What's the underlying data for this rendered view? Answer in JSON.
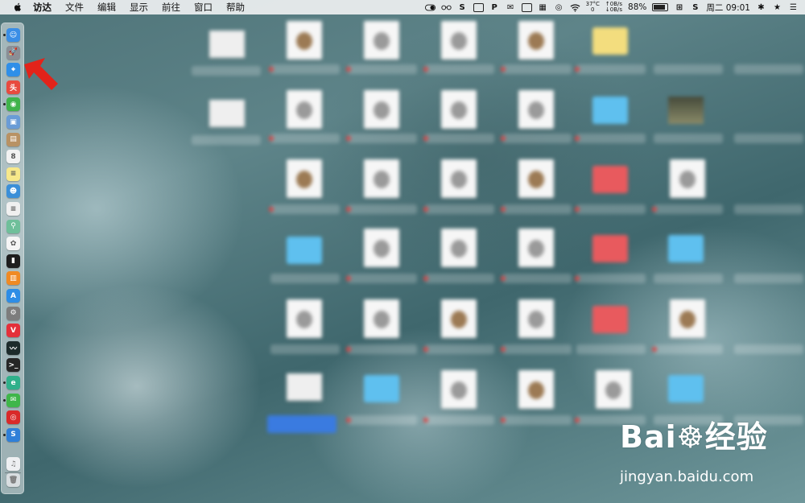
{
  "menubar": {
    "items": [
      "访达",
      "文件",
      "编辑",
      "显示",
      "前往",
      "窗口",
      "帮助"
    ],
    "status": {
      "temperature": "37°C",
      "temperature_sub": "0",
      "net_up": "↑0B/s",
      "net_down": "↓0B/s",
      "battery": "88%",
      "clock": "周二 09:01"
    }
  },
  "dock": {
    "apps": [
      {
        "name": "finder",
        "color": "#3a8ee6",
        "glyph": "☺"
      },
      {
        "name": "launchpad",
        "color": "#8a8f96",
        "glyph": "🚀"
      },
      {
        "name": "safari",
        "color": "#2f8fe8",
        "glyph": "⌖"
      },
      {
        "name": "toutiao",
        "color": "#e84a3f",
        "glyph": "头"
      },
      {
        "name": "android-tool",
        "color": "#3fb34a",
        "glyph": "◉"
      },
      {
        "name": "preview",
        "color": "#6a9cd6",
        "glyph": "▣"
      },
      {
        "name": "archive",
        "color": "#b89264",
        "glyph": "▤"
      },
      {
        "name": "calendar",
        "color": "#f2f2f2",
        "glyph": "8"
      },
      {
        "name": "notes",
        "color": "#f7e88a",
        "glyph": "≡"
      },
      {
        "name": "contacts",
        "color": "#3b8fd8",
        "glyph": "☻"
      },
      {
        "name": "textedit",
        "color": "#f0f0f0",
        "glyph": "≡"
      },
      {
        "name": "map-tool",
        "color": "#6fbf9a",
        "glyph": "⚲"
      },
      {
        "name": "photos",
        "color": "#f5f5f5",
        "glyph": "✿"
      },
      {
        "name": "terminal-green",
        "color": "#1e1e1e",
        "glyph": "▮"
      },
      {
        "name": "books",
        "color": "#f08a24",
        "glyph": "▥"
      },
      {
        "name": "app-store",
        "color": "#2d8de6",
        "glyph": "A"
      },
      {
        "name": "system-preferences",
        "color": "#7d7d7d",
        "glyph": "⚙"
      },
      {
        "name": "vivaldi",
        "color": "#e4303a",
        "glyph": "V"
      },
      {
        "name": "activity-monitor",
        "color": "#1d2b2b",
        "glyph": "〰"
      },
      {
        "name": "terminal",
        "color": "#262626",
        "glyph": ">_"
      },
      {
        "name": "browser-green",
        "color": "#2fb08a",
        "glyph": "e"
      },
      {
        "name": "wechat",
        "color": "#3fb64a",
        "glyph": "✉"
      },
      {
        "name": "netease-music",
        "color": "#d92a2a",
        "glyph": "◎"
      },
      {
        "name": "sogou",
        "color": "#2f7fd8",
        "glyph": "S"
      }
    ],
    "bottom": [
      {
        "name": "music-folder",
        "color": "#eef0f2",
        "glyph": "♫"
      },
      {
        "name": "trash",
        "color": "#d8dde0",
        "glyph": "🗑"
      }
    ]
  },
  "watermark": {
    "logo": "Bai☸经验",
    "url": "jingyan.baidu.com"
  }
}
